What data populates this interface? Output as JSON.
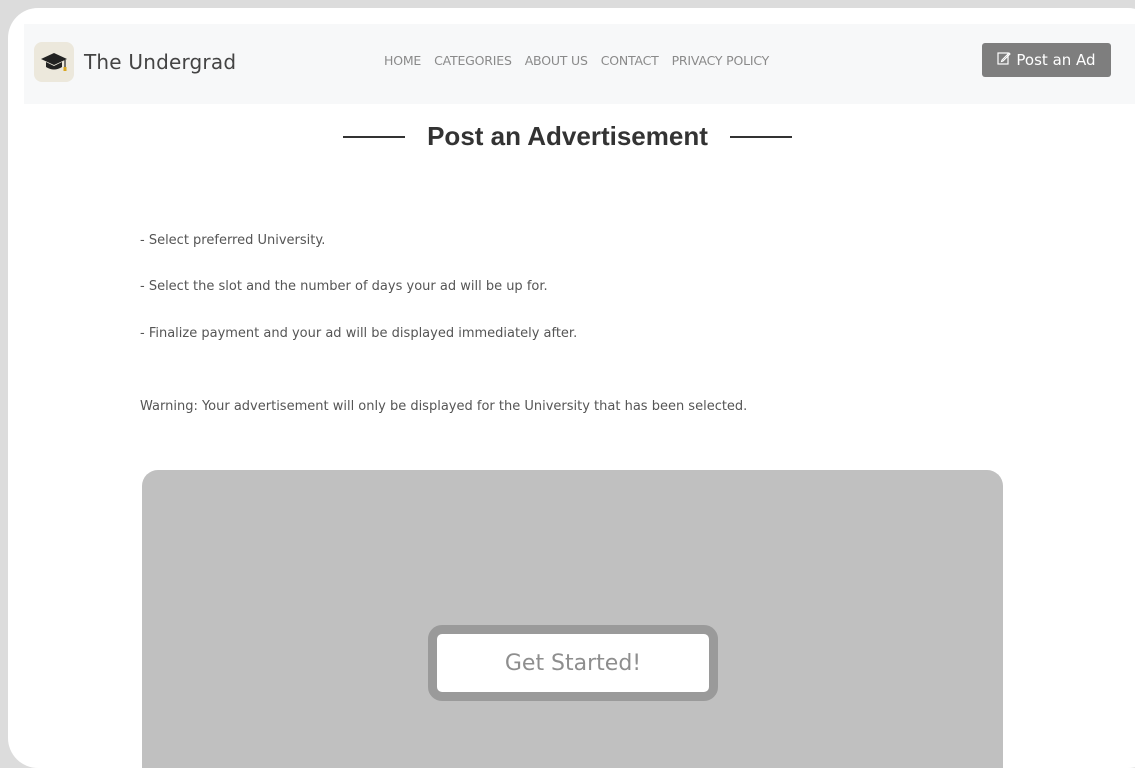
{
  "navbar": {
    "brand": "The Undergrad",
    "logo_icon": "graduation-cap-icon",
    "links": [
      "HOME",
      "CATEGORIES",
      "ABOUT US",
      "CONTACT",
      "PRIVACY POLICY"
    ],
    "post_button": "Post an Ad",
    "post_button_icon": "edit-icon"
  },
  "page": {
    "title": "Post an Advertisement",
    "instructions": [
      "- Select preferred University.",
      "- Select the slot and the number of days your ad will be up for.",
      "- Finalize payment and your ad will be displayed immediately after."
    ],
    "warning": "Warning: Your advertisement will only be displayed for the University that has been selected.",
    "cta": "Get Started!"
  },
  "colors": {
    "navbar_bg": "#f7f8f9",
    "button_bg": "#7e7e7e",
    "card_bg": "#c0c0c0"
  }
}
